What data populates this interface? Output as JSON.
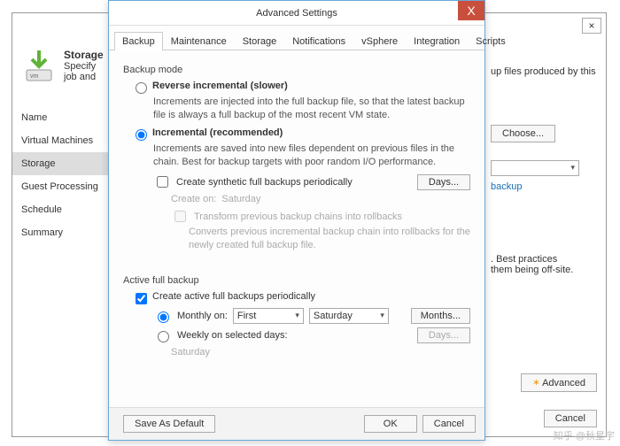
{
  "wizard": {
    "title": "Storage",
    "desc": "Specify",
    "desc2": "job and",
    "nav": [
      "Name",
      "Virtual Machines",
      "Storage",
      "Guest Processing",
      "Schedule",
      "Summary"
    ],
    "nav_selected": 2,
    "right_text_top": "up files produced by this",
    "choose": "Choose...",
    "link": "backup",
    "best_practices": ". Best practices",
    "offsite": "them being off-site.",
    "advanced": "Advanced",
    "cancel": "Cancel"
  },
  "dialog": {
    "title": "Advanced Settings",
    "tabs": [
      "Backup",
      "Maintenance",
      "Storage",
      "Notifications",
      "vSphere",
      "Integration",
      "Scripts"
    ],
    "active_tab": 0,
    "backup_mode": "Backup mode",
    "reverse": {
      "title": "Reverse incremental (slower)",
      "desc": "Increments are injected into the full backup file, so that the latest backup file is always a full backup of the most recent VM state."
    },
    "incremental": {
      "title": "Incremental (recommended)",
      "desc": "Increments are saved into new files dependent on previous files in the chain. Best for backup targets with poor random I/O performance."
    },
    "synthetic": {
      "label": "Create synthetic full backups periodically",
      "days": "Days...",
      "create_on_label": "Create on:",
      "create_on_value": "Saturday",
      "transform": "Transform previous backup chains into rollbacks",
      "transform_desc": "Converts previous incremental backup chain into rollbacks for the newly created full backup file."
    },
    "active_full": {
      "section": "Active full backup",
      "enable": "Create active full backups periodically",
      "monthly_label": "Monthly on:",
      "monthly_ord": "First",
      "monthly_day": "Saturday",
      "months": "Months...",
      "weekly_label": "Weekly on selected days:",
      "weekly_days_btn": "Days...",
      "weekly_value": "Saturday"
    },
    "buttons": {
      "save_default": "Save As Default",
      "ok": "OK",
      "cancel": "Cancel"
    }
  },
  "watermark": "知乎 @秋星宇"
}
